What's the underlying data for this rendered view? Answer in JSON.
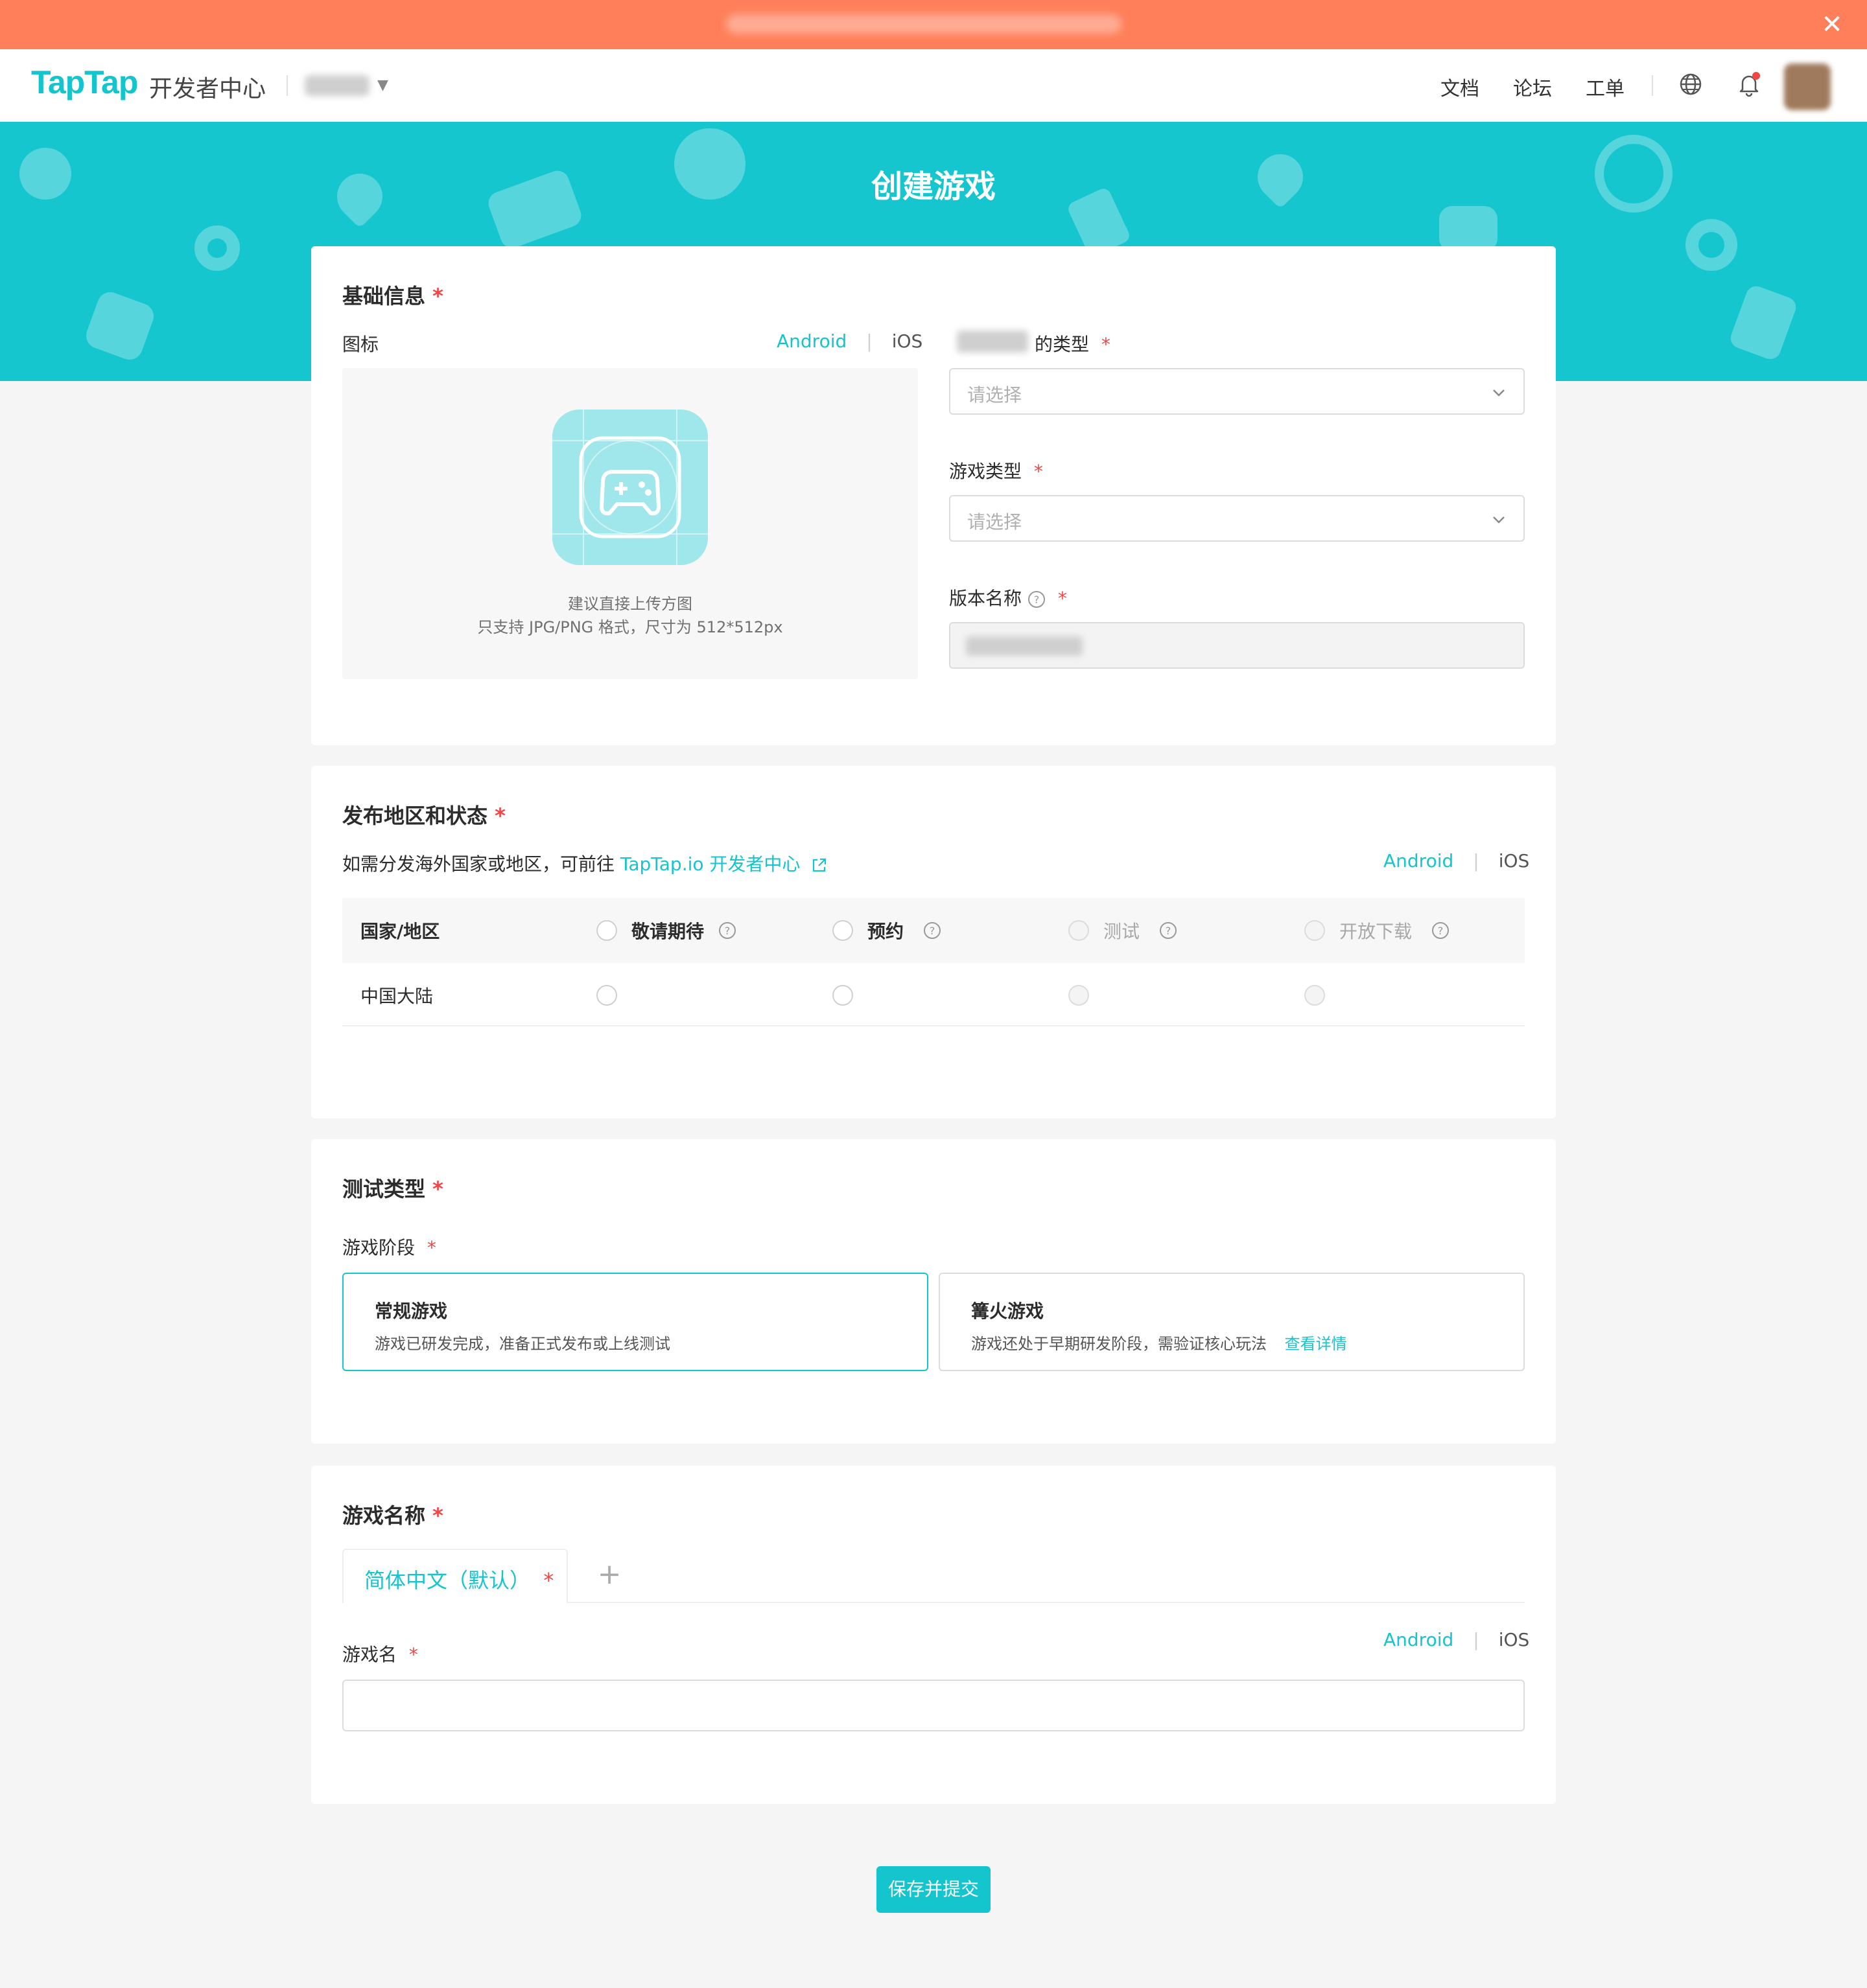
{
  "banner": {
    "close_icon": "close-icon"
  },
  "header": {
    "logo": "TapTap",
    "logo_sub": "开发者中心",
    "nav": {
      "docs": "文档",
      "forum": "论坛",
      "ticket": "工单"
    },
    "icons": {
      "globe": "globe-icon",
      "bell": "bell-icon"
    }
  },
  "hero": {
    "title": "创建游戏"
  },
  "basic": {
    "title": "基础信息",
    "required": "*",
    "icon_label": "图标",
    "platform": {
      "android": "Android",
      "ios": "iOS"
    },
    "upload_hint_1": "建议直接上传方图",
    "upload_hint_2": "只支持 JPG/PNG 格式，尺寸为 512*512px",
    "type_label": "的类型",
    "type_placeholder": "请选择",
    "game_type_label": "游戏类型",
    "game_type_placeholder": "请选择",
    "version_label": "版本名称"
  },
  "region": {
    "title": "发布地区和状态",
    "note_prefix": "如需分发海外国家或地区，可前往 ",
    "note_link": "TapTap.io 开发者中心",
    "platform": {
      "android": "Android",
      "ios": "iOS"
    },
    "columns": [
      "国家/地区",
      "敬请期待",
      "预约",
      "测试",
      "开放下载"
    ],
    "rows": [
      {
        "name": "中国大陆"
      }
    ]
  },
  "test": {
    "title": "测试类型",
    "stage_label": "游戏阶段",
    "options": [
      {
        "title": "常规游戏",
        "desc": "游戏已研发完成，准备正式发布或上线测试"
      },
      {
        "title": "篝火游戏",
        "desc": "游戏还处于早期研发阶段，需验证核心玩法",
        "link": "查看详情"
      }
    ]
  },
  "name": {
    "title": "游戏名称",
    "tab_label": "简体中文（默认）",
    "add_tab": "+",
    "field_label": "游戏名",
    "platform": {
      "android": "Android",
      "ios": "iOS"
    },
    "field_value": ""
  },
  "actions": {
    "submit": "保存并提交"
  },
  "colors": {
    "accent": "#15c5ce",
    "banner": "#ff7f5a",
    "required": "#f04646"
  }
}
